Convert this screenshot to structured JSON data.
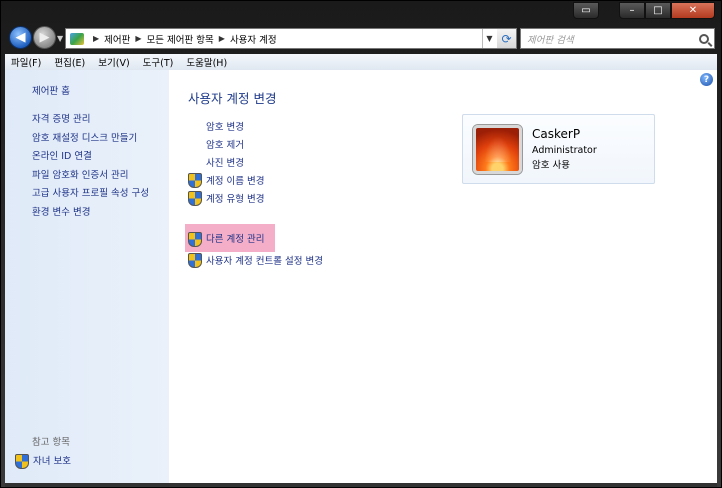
{
  "address": {
    "crumbs": [
      "제어판",
      "모든 제어판 항목",
      "사용자 계정"
    ]
  },
  "search": {
    "placeholder": "제어판 검색"
  },
  "menu": [
    "파일(F)",
    "편집(E)",
    "보기(V)",
    "도구(T)",
    "도움말(H)"
  ],
  "sidebar": {
    "home": "제어판 홈",
    "links": [
      "자격 증명 관리",
      "암호 재설정 디스크 만들기",
      "온라인 ID 연결",
      "파일 암호화 인증서 관리",
      "고급 사용자 프로필 속성 구성",
      "환경 변수 변경"
    ],
    "see_also": "참고 항목",
    "parental": "자녀 보호"
  },
  "main": {
    "title": "사용자 계정 변경",
    "tasks": [
      {
        "label": "암호 변경",
        "shield": false
      },
      {
        "label": "암호 제거",
        "shield": false
      },
      {
        "label": "사진 변경",
        "shield": false
      },
      {
        "label": "계정 이름 변경",
        "shield": true
      },
      {
        "label": "계정 유형 변경",
        "shield": true
      }
    ],
    "manage_other": "다른 계정 관리",
    "uac": "사용자 계정 컨트롤 설정 변경"
  },
  "user": {
    "name": "CaskerP",
    "role": "Administrator",
    "password_status": "암호 사용"
  },
  "colors": {
    "link": "#1e3287",
    "highlight": "#f4aec8",
    "title": "#1e3a8a"
  }
}
